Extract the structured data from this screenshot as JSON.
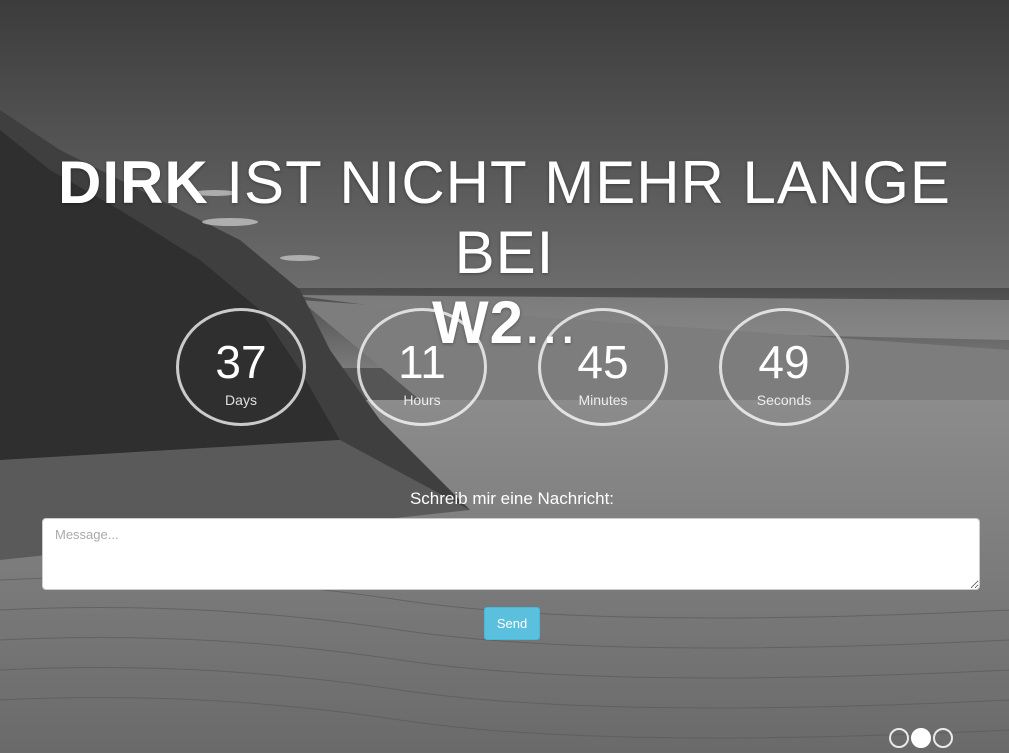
{
  "headline": {
    "part1_bold": "DIRK",
    "part2": " IST NICHT MEHR LANGE BEI",
    "part3_bold": "W2",
    "part4": "..."
  },
  "countdown": [
    {
      "value": "37",
      "unit": "Days"
    },
    {
      "value": "11",
      "unit": "Hours"
    },
    {
      "value": "45",
      "unit": "Minutes"
    },
    {
      "value": "49",
      "unit": "Seconds"
    }
  ],
  "form": {
    "prompt": "Schreib mir eine Nachricht:",
    "message_placeholder": "Message...",
    "send_label": "Send"
  },
  "slider": {
    "dot_count": 3,
    "active_index": 1
  },
  "colors": {
    "send_button": "#5bc0de"
  }
}
